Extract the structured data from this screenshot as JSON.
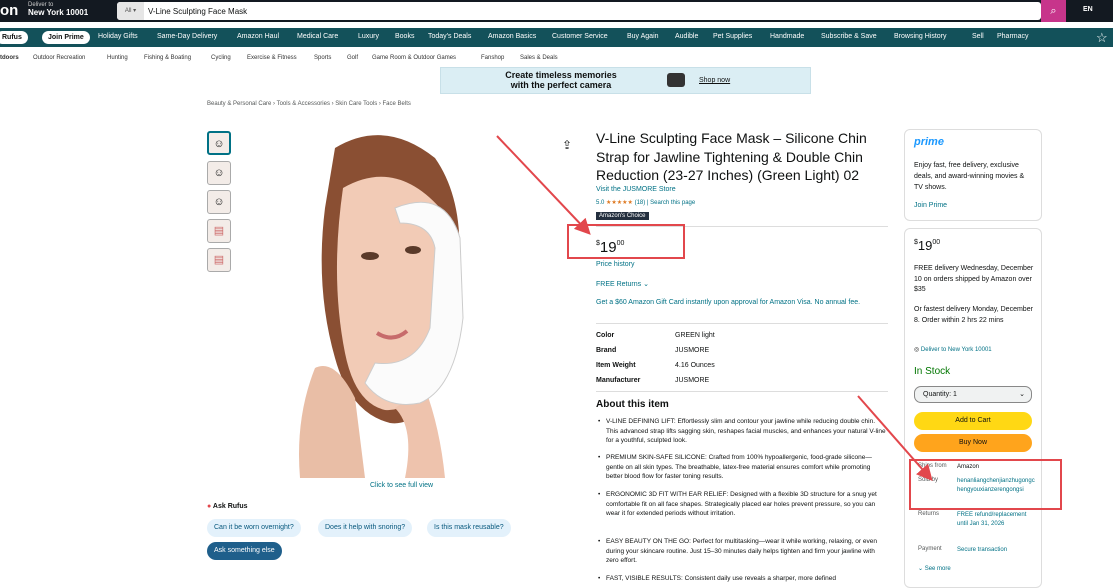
{
  "header": {
    "logo": "on",
    "deliver_label": "Deliver to",
    "deliver_location": "New York 10001",
    "search_category": "All",
    "search_value": "V-Line Sculpting Face Mask",
    "lang": "EN"
  },
  "nav": {
    "rufus": "Rufus",
    "join_prime": "Join Prime",
    "items": [
      "Holiday Gifts",
      "Same-Day Delivery",
      "Amazon Haul",
      "Medical Care",
      "Luxury",
      "Books",
      "Today's Deals",
      "Amazon Basics",
      "Customer Service",
      "Buy Again",
      "Audible",
      "Pet Supplies",
      "Handmade",
      "Subscribe & Save",
      "Browsing History",
      "Sell",
      "Pharmacy"
    ]
  },
  "subnav": [
    "tdoors",
    "Outdoor Recreation",
    "Hunting",
    "Fishing & Boating",
    "Cycling",
    "Exercise & Fitness",
    "Sports",
    "Golf",
    "Game Room & Outdoor Games",
    "Fanshop",
    "Sales & Deals"
  ],
  "banner": {
    "text1": "Create timeless memories",
    "text2": "with the perfect camera",
    "shop": "Shop now"
  },
  "breadcrumb": "Beauty & Personal Care › Tools & Accessories › Skin Care Tools › Face Belts",
  "gallery": {
    "click_full": "Click to see full view"
  },
  "rufus": {
    "title": "Ask Rufus",
    "chips": [
      "Can it be worn overnight?",
      "Does it help with snoring?",
      "Is this mask reusable?"
    ],
    "ask": "Ask something else"
  },
  "product": {
    "title": "V-Line Sculpting Face Mask – Silicone Chin Strap for Jawline Tightening & Double Chin Reduction (23-27 Inches) (Green Light) 02",
    "store": "Visit the JUSMORE Store",
    "rating": "5.0",
    "stars": "★★★★★",
    "reviews": "(18)",
    "search_page": "Search this page",
    "choice": "Amazon's Choice",
    "price_sym": "$",
    "price_whole": "19",
    "price_frac": "00",
    "price_history": "Price history",
    "returns": "FREE Returns",
    "gift_card": "Get a $60 Amazon Gift Card instantly upon approval for Amazon Visa. No annual fee."
  },
  "specs": [
    {
      "k": "Color",
      "v": "GREEN light"
    },
    {
      "k": "Brand",
      "v": "JUSMORE"
    },
    {
      "k": "Item Weight",
      "v": "4.16 Ounces"
    },
    {
      "k": "Manufacturer",
      "v": "JUSMORE"
    }
  ],
  "about": {
    "title": "About this item",
    "bullets": [
      "V-LINE DEFINING LIFT: Effortlessly slim and contour your jawline while reducing double chin. This advanced strap lifts sagging skin, reshapes facial muscles, and enhances your natural V-line for a youthful, sculpted look.",
      "PREMIUM SKIN-SAFE SILICONE: Crafted from 100% hypoallergenic, food-grade silicone—gentle on all skin types. The breathable, latex-free material ensures comfort while promoting better blood flow for faster toning results.",
      "ERGONOMIC 3D FIT WITH EAR RELIEF: Designed with a flexible 3D structure for a snug yet comfortable fit on all face shapes. Strategically placed ear holes prevent pressure, so you can wear it for extended periods without irritation.",
      "EASY BEAUTY ON THE GO: Perfect for multitasking—wear it while working, relaxing, or even during your skincare routine. Just 15–30 minutes daily helps tighten and firm your jawline with zero effort.",
      "FAST, VISIBLE RESULTS: Consistent daily use reveals a sharper, more defined"
    ]
  },
  "prime": {
    "logo": "prime",
    "text": "Enjoy fast, free delivery, exclusive deals, and award-winning movies & TV shows.",
    "join": "Join Prime"
  },
  "buybox": {
    "price_sym": "$",
    "price_whole": "19",
    "price_frac": "00",
    "delivery1": "FREE delivery Wednesday, December 10 on orders shipped by Amazon over $35",
    "delivery2": "Or fastest delivery Monday, December 8. Order within 2 hrs 22 mins",
    "deliver_to": "Deliver to New York 10001",
    "stock": "In Stock",
    "quantity": "Quantity: 1",
    "add": "Add to Cart",
    "buy": "Buy Now",
    "ships_from_l": "Ships from",
    "ships_from_v": "Amazon",
    "sold_by_l": "Sold by",
    "sold_by_v": "henanliangchenjianzhugongchengyouxianzerengongsi",
    "returns_l": "Returns",
    "returns_v": "FREE refund/replacement until Jan 31, 2026",
    "payment_l": "Payment",
    "payment_v": "Secure transaction",
    "see_more": "See more"
  },
  "colors": {
    "header": "#131921",
    "nav": "#13515a",
    "accent": "#e2474c",
    "add": "#ffd814",
    "buy": "#ffa41c",
    "link": "#007185"
  }
}
